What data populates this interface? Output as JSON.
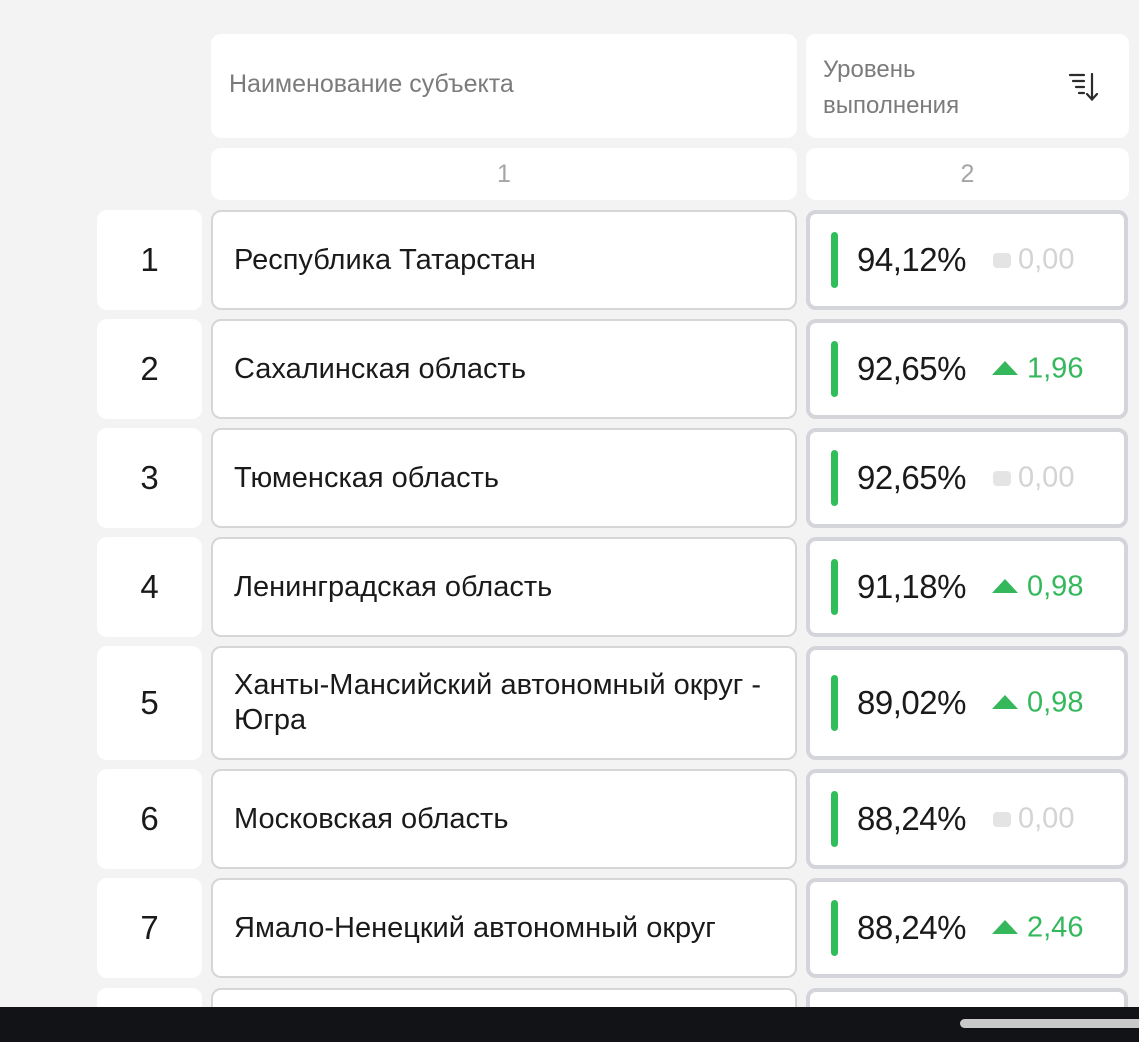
{
  "header": {
    "name_column_label": "Наименование субъекта",
    "level_column_label": "Уровень выполнения",
    "sort_icon": "sort-descending-icon",
    "name_column_number": "1",
    "level_column_number": "2"
  },
  "rows": [
    {
      "rank": "1",
      "name": "Республика Татарстан",
      "level": "94,12%",
      "delta": "0,00",
      "trend": "neutral"
    },
    {
      "rank": "2",
      "name": "Сахалинская область",
      "level": "92,65%",
      "delta": "1,96",
      "trend": "up"
    },
    {
      "rank": "3",
      "name": "Тюменская область",
      "level": "92,65%",
      "delta": "0,00",
      "trend": "neutral"
    },
    {
      "rank": "4",
      "name": "Ленинградская область",
      "level": "91,18%",
      "delta": "0,98",
      "trend": "up"
    },
    {
      "rank": "5",
      "name": "Ханты-Мансийский автономный округ - Югра",
      "level": "89,02%",
      "delta": "0,98",
      "trend": "up"
    },
    {
      "rank": "6",
      "name": "Московская область",
      "level": "88,24%",
      "delta": "0,00",
      "trend": "neutral"
    },
    {
      "rank": "7",
      "name": "Ямало-Ненецкий автономный округ",
      "level": "88,24%",
      "delta": "2,46",
      "trend": "up"
    }
  ],
  "colors": {
    "level_bar": "#2fbe5a",
    "delta_up": "#35b85c",
    "delta_neutral": "#d3d3d3"
  }
}
